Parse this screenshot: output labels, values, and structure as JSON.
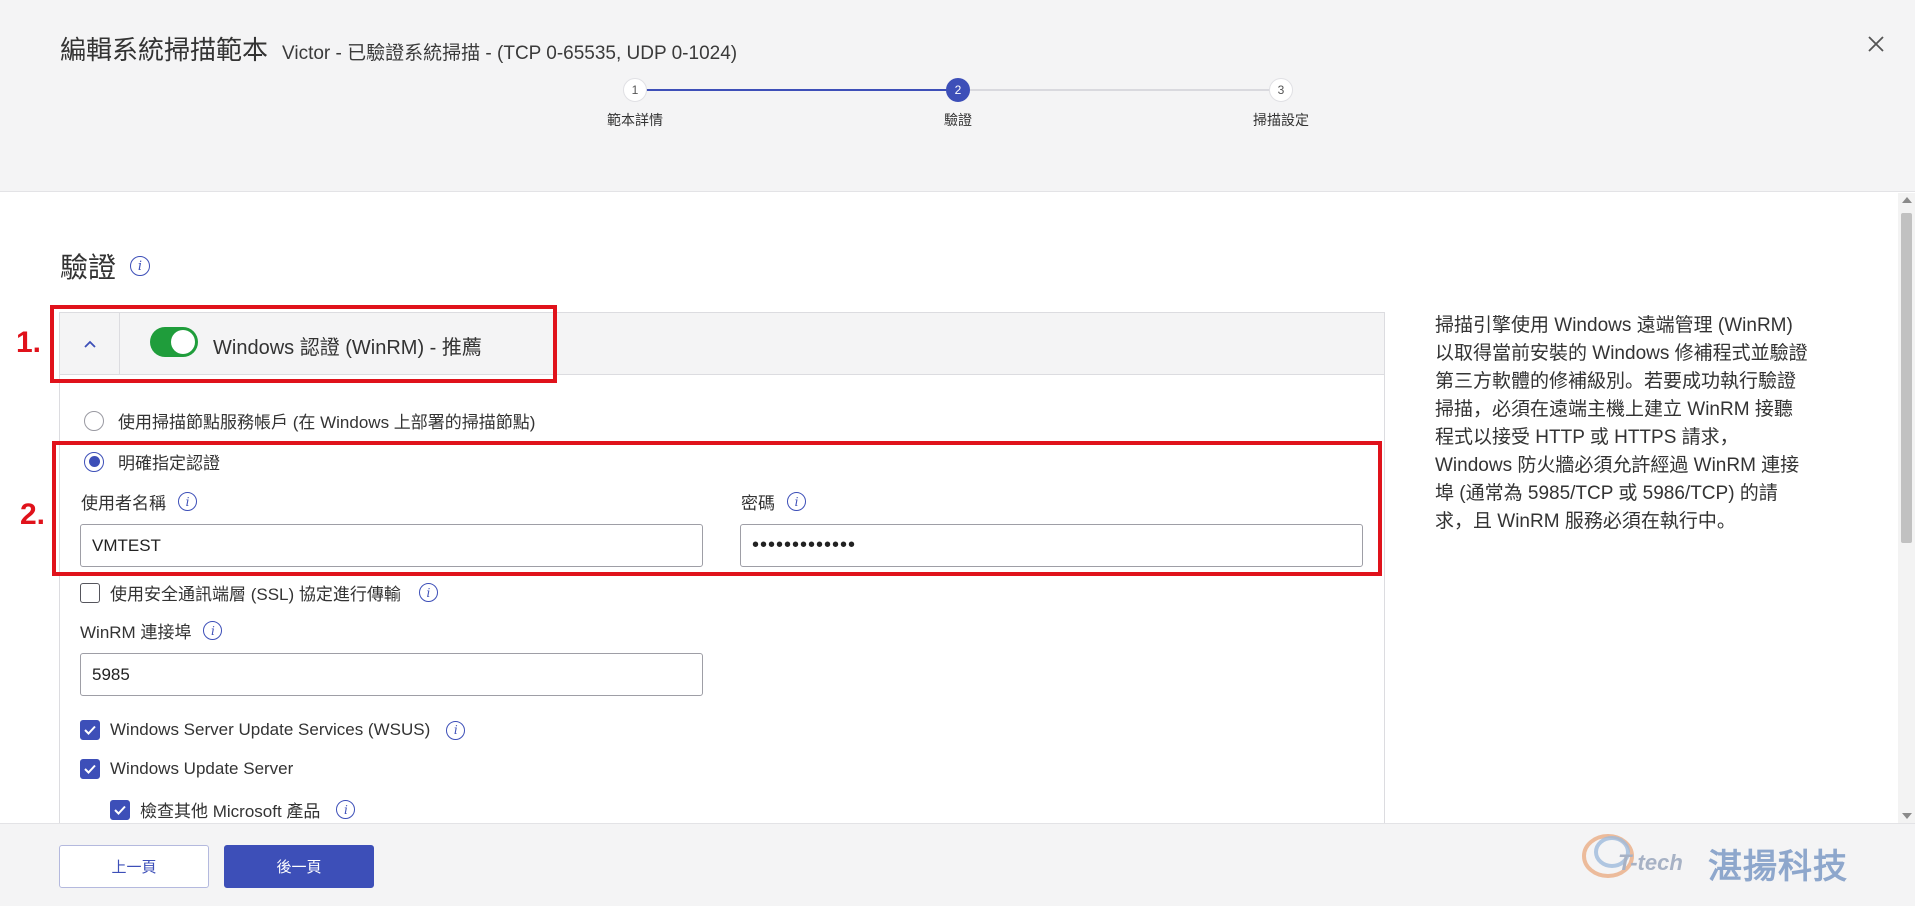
{
  "header": {
    "title": "編輯系統掃描範本",
    "subtitle": "Victor - 已驗證系統掃描 - (TCP 0-65535, UDP 0-1024)",
    "close_icon": "close-icon",
    "steps": [
      {
        "number": "1",
        "label": "範本詳情",
        "state": "done"
      },
      {
        "number": "2",
        "label": "驗證",
        "state": "active"
      },
      {
        "number": "3",
        "label": "掃描設定",
        "state": "todo"
      }
    ]
  },
  "section": {
    "title": "驗證",
    "info_icon": "info-icon"
  },
  "winrm": {
    "header_label": "Windows 認證 (WinRM) - 推薦",
    "enabled": true,
    "option_service_account": "使用掃描節點服務帳戶 (在 Windows 上部署的掃描節點)",
    "option_explicit": "明確指定認證",
    "selected_option": "explicit",
    "username_label": "使用者名稱",
    "username_value": "VMTEST",
    "password_label": "密碼",
    "password_value": "•••••••••••••",
    "ssl_label": "使用安全通訊端層 (SSL) 協定進行傳輸",
    "ssl_checked": false,
    "port_label": "WinRM 連接埠",
    "port_value": "5985",
    "wsus_label": "Windows Server Update Services (WSUS)",
    "wsus_checked": true,
    "update_server_label": "Windows Update Server",
    "update_server_checked": true,
    "other_ms_label": "檢查其他 Microsoft 產品",
    "other_ms_checked": true
  },
  "help_text": "掃描引擎使用 Windows 遠端管理 (WinRM) 以取得當前安裝的 Windows 修補程式並驗證第三方軟體的修補級別。若要成功執行驗證掃描，必須在遠端主機上建立 WinRM 接聽程式以接受 HTTP 或 HTTPS 請求，Windows 防火牆必須允許經過 WinRM 連接埠 (通常為 5985/TCP 或 5986/TCP) 的請求，且 WinRM 服務必須在執行中。",
  "annotations": {
    "label_1": "1.",
    "label_2": "2.",
    "color": "#e0121b"
  },
  "footer": {
    "prev_label": "上一頁",
    "next_label": "後一頁"
  },
  "watermark": {
    "brand": "T-tech",
    "name": "湛揚科技"
  },
  "colors": {
    "accent": "#3d4fb8",
    "toggle_on": "#1f9d3b"
  }
}
